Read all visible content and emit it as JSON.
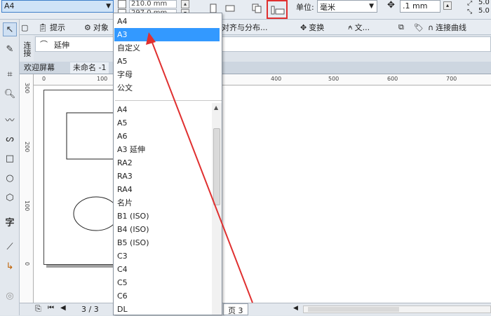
{
  "propbar": {
    "paper_size": "A4",
    "width_value": "210.0 mm",
    "height_value": "297.0 mm",
    "unit_label": "单位:",
    "unit_value": "毫米",
    "nudge_value": ".1 mm",
    "dup_x": "5.0",
    "dup_y": "5.0"
  },
  "tabs": {
    "hint": "提示",
    "object": "对象",
    "align": "对齐与分布...",
    "transform": "变换",
    "text": "文...",
    "connector": "连接曲线"
  },
  "hint_field": {
    "text": "延伸"
  },
  "side_label": "连接",
  "doc_tabs": {
    "welcome": "欢迎屏幕",
    "untitled": "未命名 -1"
  },
  "rulers": {
    "h": [
      "0",
      "100",
      "400",
      "500",
      "600",
      "700"
    ],
    "v": [
      "300",
      "200",
      "100",
      "0"
    ]
  },
  "bottom": {
    "page_count": "3 / 3",
    "page_tab": "页 3"
  },
  "dropdown": {
    "top_items": [
      "A4",
      "A3",
      "自定义",
      "A5",
      "字母",
      "公文"
    ],
    "selected_index": 1,
    "list_items": [
      "A4",
      "A5",
      "A6",
      "A3 延伸",
      "RA2",
      "RA3",
      "RA4",
      "名片",
      "B1 (ISO)",
      "B4 (ISO)",
      "B5 (ISO)",
      "C3",
      "C4",
      "C5",
      "C6",
      "DL"
    ]
  },
  "colors": {
    "selection": "#3399ff",
    "annotation": "#e03030",
    "accent": "#3f7fc9"
  }
}
